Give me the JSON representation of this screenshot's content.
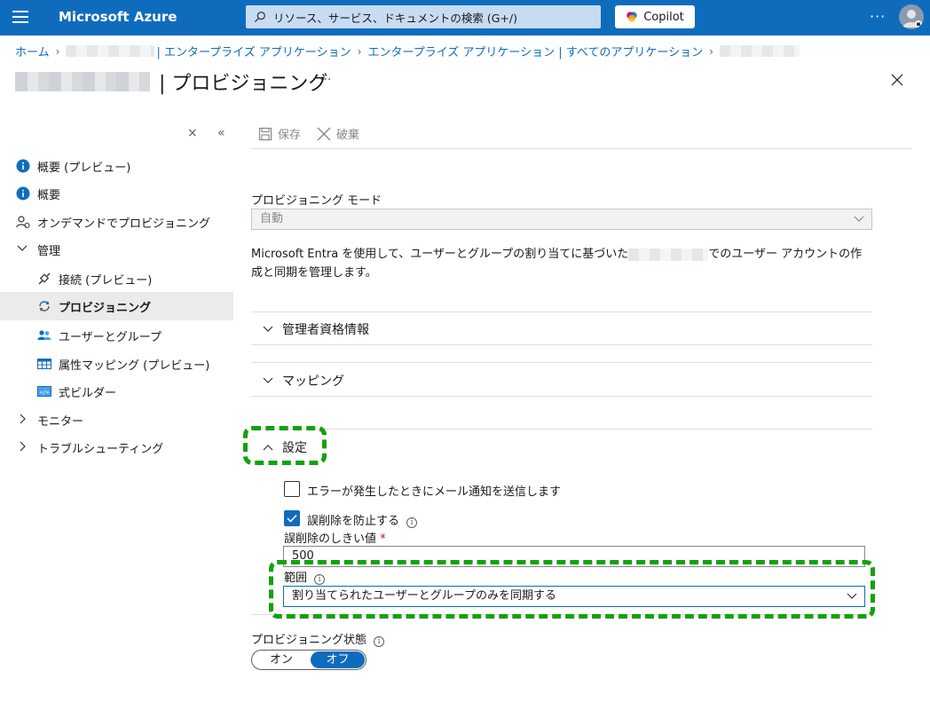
{
  "header": {
    "brand": "Microsoft Azure",
    "search_placeholder": "リソース、サービス、ドキュメントの検索 (G+/)",
    "copilot_label": "Copilot",
    "more": "···"
  },
  "breadcrumb": {
    "home": "ホーム",
    "enterprise_apps": "| エンタープライズ アプリケーション",
    "all_apps": "エンタープライズ アプリケーション | すべてのアプリケーション"
  },
  "page": {
    "title": "| プロビジョニング",
    "more": "···"
  },
  "sidebar": {
    "collapse_symbol": "«",
    "close_symbol": "×",
    "items": [
      {
        "label": "概要 (プレビュー)"
      },
      {
        "label": "概要"
      },
      {
        "label": "オンデマンドでプロビジョニング"
      },
      {
        "label": "管理"
      },
      {
        "label": "接続 (プレビュー)"
      },
      {
        "label": "プロビジョニング"
      },
      {
        "label": "ユーザーとグループ"
      },
      {
        "label": "属性マッピング (プレビュー)"
      },
      {
        "label": "式ビルダー"
      },
      {
        "label": "モニター"
      },
      {
        "label": "トラブルシューティング"
      }
    ]
  },
  "toolbar": {
    "save_label": "保存",
    "discard_label": "破棄"
  },
  "content": {
    "mode_label": "プロビジョニング モード",
    "mode_value": "自動",
    "description_before": "Microsoft Entra を使用して、ユーザーとグループの割り当てに基づいた",
    "description_after": "でのユーザー アカウントの作成と同期を管理します。",
    "section_admin": "管理者資格情報",
    "section_mapping": "マッピング",
    "section_settings": "設定",
    "email_notify_label": "エラーが発生したときにメール通知を送信します",
    "email_notify_checked": false,
    "prevent_delete_label": "誤削除を防止する",
    "prevent_delete_checked": true,
    "threshold_label": "誤削除のしきい値",
    "required_mark": "*",
    "threshold_value": "500",
    "scope_label": "範囲",
    "scope_value": "割り当てられたユーザーとグループのみを同期する",
    "status_label": "プロビジョニング状態",
    "toggle_on": "オン",
    "toggle_off": "オフ",
    "toggle_state": "off"
  },
  "colors": {
    "azure_blue": "#0f6cbd",
    "highlight_green": "#13a10e"
  }
}
